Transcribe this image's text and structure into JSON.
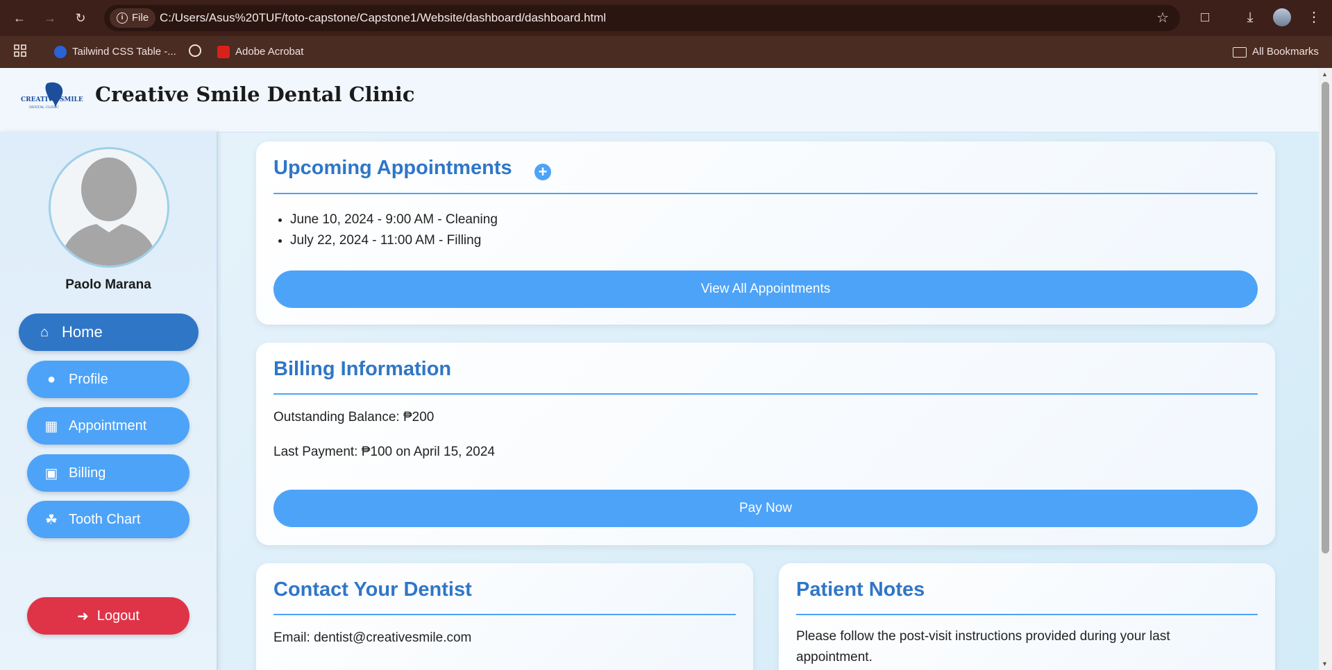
{
  "browser": {
    "url": "C:/Users/Asus%20TUF/toto-capstone/Capstone1/Website/dashboard/dashboard.html",
    "file_chip": "File",
    "bookmarks": [
      "Tailwind CSS Table -...",
      "Adobe Acrobat"
    ],
    "all_bookmarks": "All Bookmarks"
  },
  "header": {
    "title": "Creative Smile Dental Clinic",
    "logo_text": "CREATIVE SMILE",
    "logo_sub": "DENTAL CLINIC"
  },
  "sidebar": {
    "username": "Paolo Marana",
    "items": [
      {
        "label": "Home",
        "icon": "home-icon"
      },
      {
        "label": "Profile",
        "icon": "user-icon"
      },
      {
        "label": "Appointment",
        "icon": "calendar-icon"
      },
      {
        "label": "Billing",
        "icon": "invoice-icon"
      },
      {
        "label": "Tooth Chart",
        "icon": "tooth-icon"
      }
    ],
    "logout": "Logout"
  },
  "appointments": {
    "title": "Upcoming Appointments",
    "items": [
      "June 10, 2024 - 9:00 AM - Cleaning",
      "July 22, 2024 - 11:00 AM - Filling"
    ],
    "button": "View All Appointments"
  },
  "billing": {
    "title": "Billing Information",
    "outstanding": "Outstanding Balance: ₱200",
    "last_payment": "Last Payment: ₱100 on April 15, 2024",
    "button": "Pay Now"
  },
  "contact": {
    "title": "Contact Your Dentist",
    "email": "Email: dentist@creativesmile.com"
  },
  "notes": {
    "title": "Patient Notes",
    "text": "Please follow the post-visit instructions provided during your last appointment."
  }
}
